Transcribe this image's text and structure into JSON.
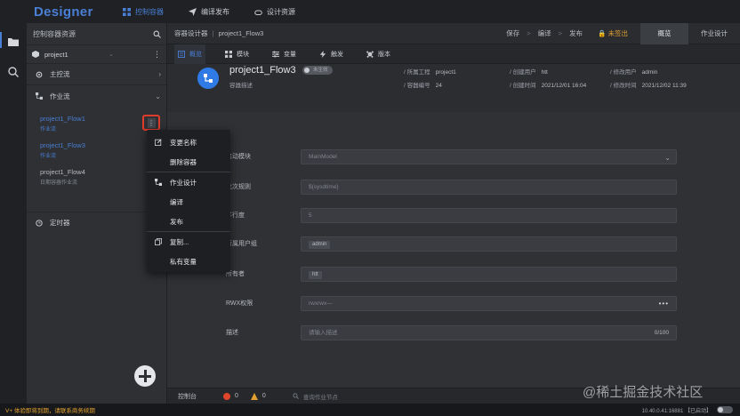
{
  "app": {
    "title": "Designer"
  },
  "topnav": [
    {
      "label": "控制容器",
      "icon": "app-grid-icon",
      "active": true
    },
    {
      "label": "编译发布",
      "icon": "paper-plane-icon",
      "active": false
    },
    {
      "label": "设计资源",
      "icon": "cloud-icon",
      "active": false
    }
  ],
  "rail": [
    {
      "icon": "folder-icon"
    },
    {
      "icon": "search-icon"
    }
  ],
  "panel": {
    "title": "控制容器资源",
    "project": "project1",
    "groups": [
      {
        "label": "主控流",
        "icon": "flow-gear-icon"
      },
      {
        "label": "作业流",
        "icon": "workflow-icon"
      }
    ],
    "flows": [
      {
        "name": "project1_Flow1",
        "sub": "作业流",
        "highlight": true
      },
      {
        "name": "project1_Flow3",
        "sub": "作业流",
        "highlight": true
      },
      {
        "name": "project1_Flow4",
        "sub": "日期容器作业流",
        "highlight": false
      }
    ],
    "timer": "定时器",
    "kebab": "⋮"
  },
  "context_menu": [
    {
      "label": "变更名称",
      "icon": "edit-icon"
    },
    {
      "label": "删除容器",
      "icon": ""
    },
    {
      "label": "作业设计",
      "icon": "design-icon"
    },
    {
      "label": "编译",
      "icon": ""
    },
    {
      "label": "发布",
      "icon": ""
    },
    {
      "label": "复制...",
      "icon": "copy-icon"
    },
    {
      "label": "私有变量",
      "icon": ""
    }
  ],
  "crumb": {
    "root": "容器设计器",
    "current": "project1_Flow3"
  },
  "actions": {
    "save": "保存",
    "compile": "编译",
    "publish": "发布",
    "arrow": ">",
    "unlock": "🔒 未签出"
  },
  "right_tabs": {
    "overview": "概览",
    "workflow": "作业设计"
  },
  "tabs": [
    {
      "label": "概览",
      "icon": "overview-icon",
      "active": true
    },
    {
      "label": "模块",
      "icon": "module-icon",
      "active": false
    },
    {
      "label": "变量",
      "icon": "variable-icon",
      "active": false
    },
    {
      "label": "触发",
      "icon": "trigger-icon",
      "active": false
    },
    {
      "label": "版本",
      "icon": "version-icon",
      "active": false
    }
  ],
  "overview": {
    "title": "project1_Flow3",
    "badge": "未生效",
    "desc": "容器描述",
    "meta": [
      {
        "label": "所属工程",
        "value": "project1"
      },
      {
        "label": "创建用户",
        "value": "htt"
      },
      {
        "label": "修改用户",
        "value": "admin"
      },
      {
        "label": "容器编号",
        "value": "24"
      },
      {
        "label": "创建时间",
        "value": "2021/12/01 16:04"
      },
      {
        "label": "修改时间",
        "value": "2021/12/02 11:39"
      }
    ]
  },
  "form": {
    "fields": [
      {
        "label": "启动模块",
        "value": "MainModel"
      },
      {
        "label": "批次规则",
        "value": "${sysdtime}"
      },
      {
        "label": "并行度",
        "value": "5"
      },
      {
        "label": "所属用户组",
        "value": "admin"
      },
      {
        "label": "所有者",
        "value": "htt"
      },
      {
        "label": "RWX权限",
        "value": "rwxrwx---"
      },
      {
        "label": "描述",
        "value": "请输入描述",
        "counter": "0/100"
      }
    ]
  },
  "console": {
    "label": "控制台",
    "errors": "0",
    "warnings": "0",
    "search_placeholder": "查询作业节点"
  },
  "status": {
    "message": "V+ 体验即将到期，请联系商务续期",
    "right": "10.40.0.41:16881 【已启动】"
  },
  "watermark": "@稀土掘金技术社区",
  "colors": {
    "accent": "#4a7fd6",
    "warning": "#e0a030",
    "error": "#e0452b",
    "highlight_border": "#e03b2b"
  }
}
